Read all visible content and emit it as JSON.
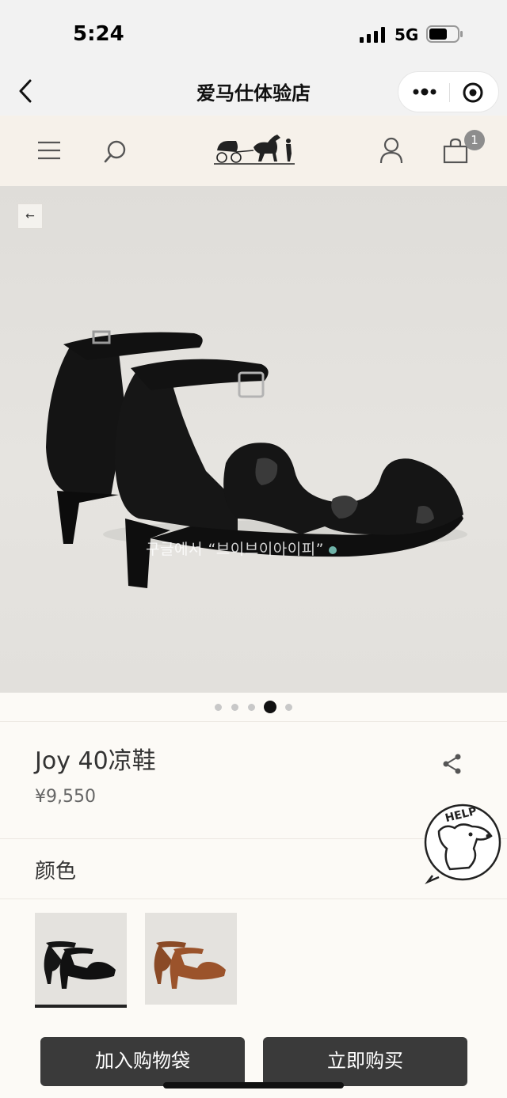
{
  "status_bar": {
    "time": "5:24",
    "network": "5G"
  },
  "mini_program": {
    "title": "爱马仕体验店"
  },
  "header": {
    "cart_count": "1"
  },
  "product": {
    "name": "Joy 40凉鞋",
    "price": "¥9,550",
    "image_overlay_text": "구글에서 “브이브이아이피”",
    "gallery": {
      "total": 5,
      "active_index": 3
    }
  },
  "color_section": {
    "label": "颜色",
    "options": [
      "black",
      "brown"
    ],
    "selected": "black"
  },
  "help_badge": {
    "text": "HELP"
  },
  "actions": {
    "add_to_bag": "加入购物袋",
    "buy_now": "立即购买"
  },
  "colors": {
    "button_bg": "#3a3a3a",
    "page_bg": "#fcfaf6",
    "header_bg": "#f6f1ea"
  }
}
